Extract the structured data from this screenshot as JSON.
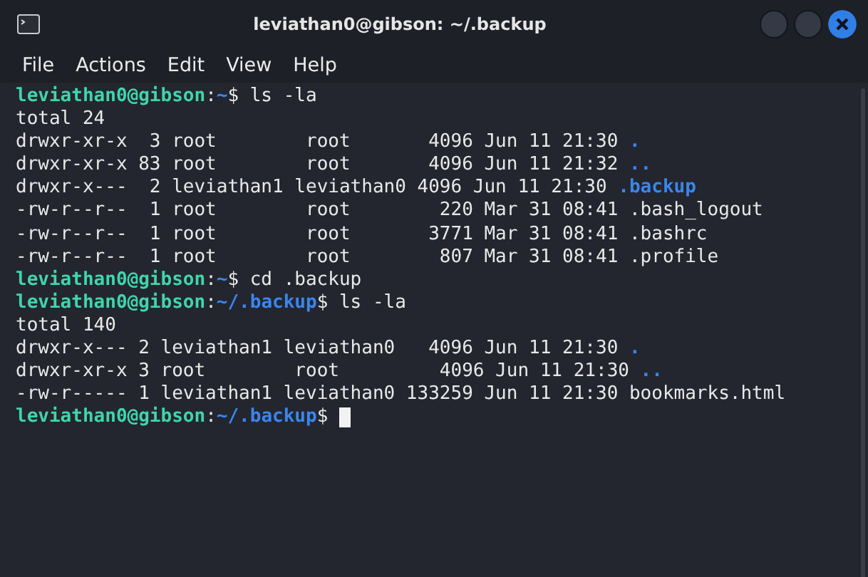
{
  "window": {
    "title": "leviathan0@gibson: ~/.backup"
  },
  "menu": [
    "File",
    "Actions",
    "Edit",
    "View",
    "Help"
  ],
  "terminal": {
    "lines": [
      {
        "kind": "prompt",
        "user": "leviathan0@gibson",
        "separator": ":",
        "path": "~",
        "symbol": "$",
        "command": "ls -la"
      },
      {
        "kind": "output",
        "text": "total 24"
      },
      {
        "kind": "listing",
        "text": "drwxr-xr-x  3 root        root       4096 Jun 11 21:30 ",
        "name": ".",
        "directory": true
      },
      {
        "kind": "listing",
        "text": "drwxr-xr-x 83 root        root       4096 Jun 11 21:32 ",
        "name": "..",
        "directory": true
      },
      {
        "kind": "listing",
        "text": "drwxr-x---  2 leviathan1 leviathan0 4096 Jun 11 21:30 ",
        "name": ".backup",
        "directory": true
      },
      {
        "kind": "listing",
        "text": "-rw-r--r--  1 root        root        220 Mar 31 08:41 ",
        "name": ".bash_logout",
        "directory": false
      },
      {
        "kind": "listing",
        "text": "-rw-r--r--  1 root        root       3771 Mar 31 08:41 ",
        "name": ".bashrc",
        "directory": false
      },
      {
        "kind": "listing",
        "text": "-rw-r--r--  1 root        root        807 Mar 31 08:41 ",
        "name": ".profile",
        "directory": false
      },
      {
        "kind": "prompt",
        "user": "leviathan0@gibson",
        "separator": ":",
        "path": "~",
        "symbol": "$",
        "command": "cd .backup"
      },
      {
        "kind": "prompt",
        "user": "leviathan0@gibson",
        "separator": ":",
        "path": "~/.backup",
        "symbol": "$",
        "command": "ls -la"
      },
      {
        "kind": "output",
        "text": "total 140"
      },
      {
        "kind": "listing",
        "text": "drwxr-x--- 2 leviathan1 leviathan0   4096 Jun 11 21:30 ",
        "name": ".",
        "directory": true
      },
      {
        "kind": "listing",
        "text": "drwxr-xr-x 3 root        root         4096 Jun 11 21:30 ",
        "name": "..",
        "directory": true
      },
      {
        "kind": "listing",
        "text": "-rw-r----- 1 leviathan1 leviathan0 133259 Jun 11 21:30 ",
        "name": "bookmarks.html",
        "directory": false
      },
      {
        "kind": "prompt",
        "user": "leviathan0@gibson",
        "separator": ":",
        "path": "~/.backup",
        "symbol": "$",
        "cursor": true
      }
    ]
  }
}
